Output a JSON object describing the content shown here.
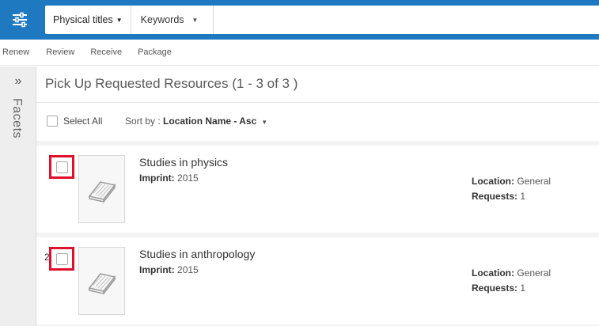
{
  "topbar": {
    "menu_icon": "sliders-icon",
    "scope": "Physical titles",
    "field": "Keywords",
    "search_value": ""
  },
  "actions": [
    "Renew",
    "Review",
    "Receive",
    "Package"
  ],
  "facets": {
    "label": "Facets",
    "toggle_icon": "double-chevron-right-icon"
  },
  "page": {
    "title": "Pick Up Requested Resources (1 - 3 of 3 )",
    "select_all": "Select All",
    "sort_prefix": "Sort by : ",
    "sort_value": "Location Name - Asc"
  },
  "labels": {
    "imprint": "Imprint:",
    "location": "Location:",
    "requests": "Requests:"
  },
  "results": [
    {
      "num": "",
      "title": "Studies in physics",
      "imprint": "2015",
      "location": "General",
      "requests": "1"
    },
    {
      "num": "2",
      "title": "Studies in anthropology",
      "imprint": "2015",
      "location": "General",
      "requests": "1"
    }
  ],
  "colors": {
    "brand": "#1f79c0",
    "highlight": "#e0102b"
  }
}
